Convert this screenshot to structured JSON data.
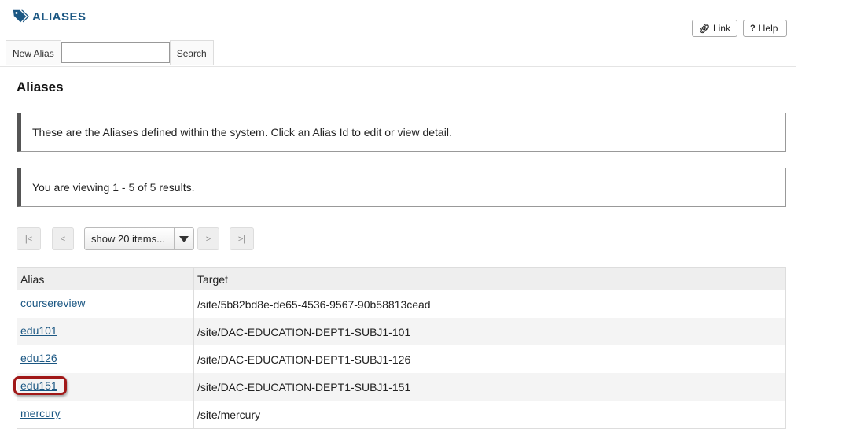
{
  "tool": {
    "title": "ALIASES",
    "icon": "tag-icon"
  },
  "toolbar": {
    "link_label": "Link",
    "help_label": "Help"
  },
  "nav": {
    "new_alias_label": "New Alias",
    "search_value": "",
    "search_label": "Search"
  },
  "page": {
    "title": "Aliases"
  },
  "messages": {
    "instructions": "These are the Aliases defined within the system. Click an Alias Id to edit or view detail.",
    "viewing": "You are viewing 1 - 5 of 5 results."
  },
  "pager": {
    "first": "|<",
    "prev": "<",
    "page_size": "show 20 items...",
    "next": ">",
    "last": ">|"
  },
  "table": {
    "columns": [
      "Alias",
      "Target"
    ],
    "rows": [
      {
        "alias": "coursereview",
        "target": "/site/5b82bd8e-de65-4536-9567-90b58813cead"
      },
      {
        "alias": "edu101",
        "target": "/site/DAC-EDUCATION-DEPT1-SUBJ1-101"
      },
      {
        "alias": "edu126",
        "target": "/site/DAC-EDUCATION-DEPT1-SUBJ1-126"
      },
      {
        "alias": "edu151",
        "target": "/site/DAC-EDUCATION-DEPT1-SUBJ1-151",
        "highlighted": true
      },
      {
        "alias": "mercury",
        "target": "/site/mercury"
      }
    ]
  },
  "colors": {
    "accent": "#1b5783",
    "highlight": "#a01818"
  }
}
